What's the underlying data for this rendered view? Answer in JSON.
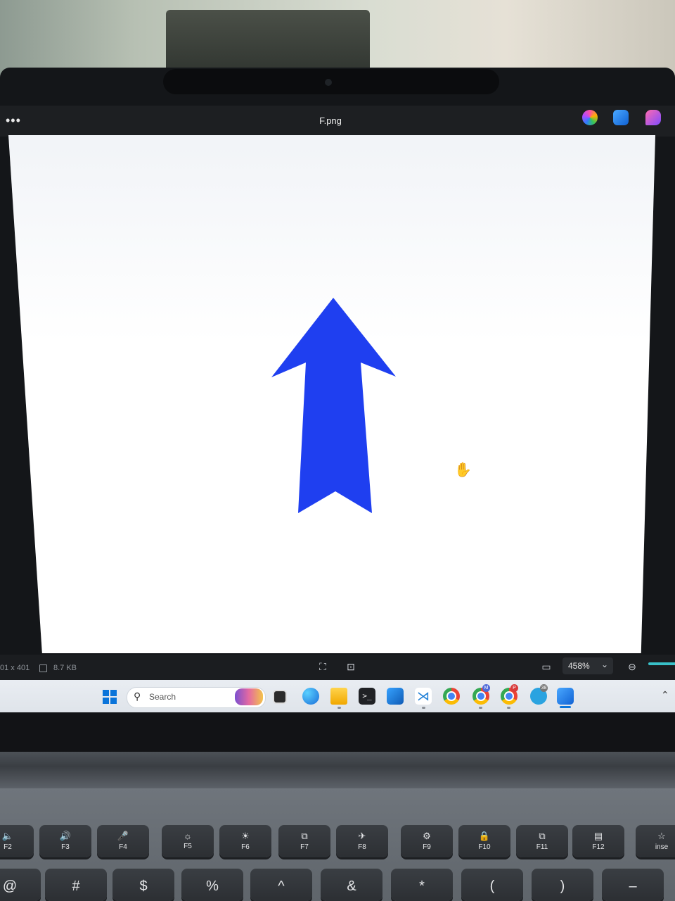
{
  "window": {
    "title": "F.png",
    "menu_glyph": "•••"
  },
  "titlebar_icons": [
    "copilot-icon",
    "photos-icon",
    "designer-icon"
  ],
  "canvas": {
    "arrow_color": "#1f3ff0",
    "background": "#ffffff",
    "cursor_glyph": "✋"
  },
  "statusbar": {
    "dimensions": "01 x 401",
    "file_size": "8.7 KB",
    "fit_glyph": "⛶",
    "actual_glyph": "⊡",
    "fullscreen_glyph": "▭",
    "zoom": "458%",
    "zoom_chevron": "⌄",
    "zoom_out_glyph": "⊖",
    "accent": "#39c1c9"
  },
  "taskbar": {
    "search_placeholder": "Search",
    "search_glyph": "⚲",
    "terminal_glyph": ">_",
    "vscode_glyph": "⋊",
    "badges": {
      "m": "M",
      "p": "P",
      "t": "38"
    },
    "tray_chevron": "⌃",
    "accent": "#0a74da"
  },
  "keyboard": {
    "fn_keys": [
      {
        "icon": "🔈",
        "label": "F2"
      },
      {
        "icon": "🔊",
        "label": "F3"
      },
      {
        "icon": "🎤",
        "label": "F4"
      },
      {
        "icon": "☼",
        "label": "F5"
      },
      {
        "icon": "☀",
        "label": "F6"
      },
      {
        "icon": "⧉",
        "label": "F7"
      },
      {
        "icon": "✈",
        "label": "F8"
      },
      {
        "icon": "⚙",
        "label": "F9"
      },
      {
        "icon": "🔒",
        "label": "F10"
      },
      {
        "icon": "⧉",
        "label": "F11"
      },
      {
        "icon": "▤",
        "label": "F12"
      },
      {
        "icon": "☆",
        "label": "inse"
      }
    ],
    "num_keys": [
      "@",
      "#",
      "$",
      "%",
      "^",
      "&",
      "*",
      "(",
      ")",
      "–"
    ]
  }
}
